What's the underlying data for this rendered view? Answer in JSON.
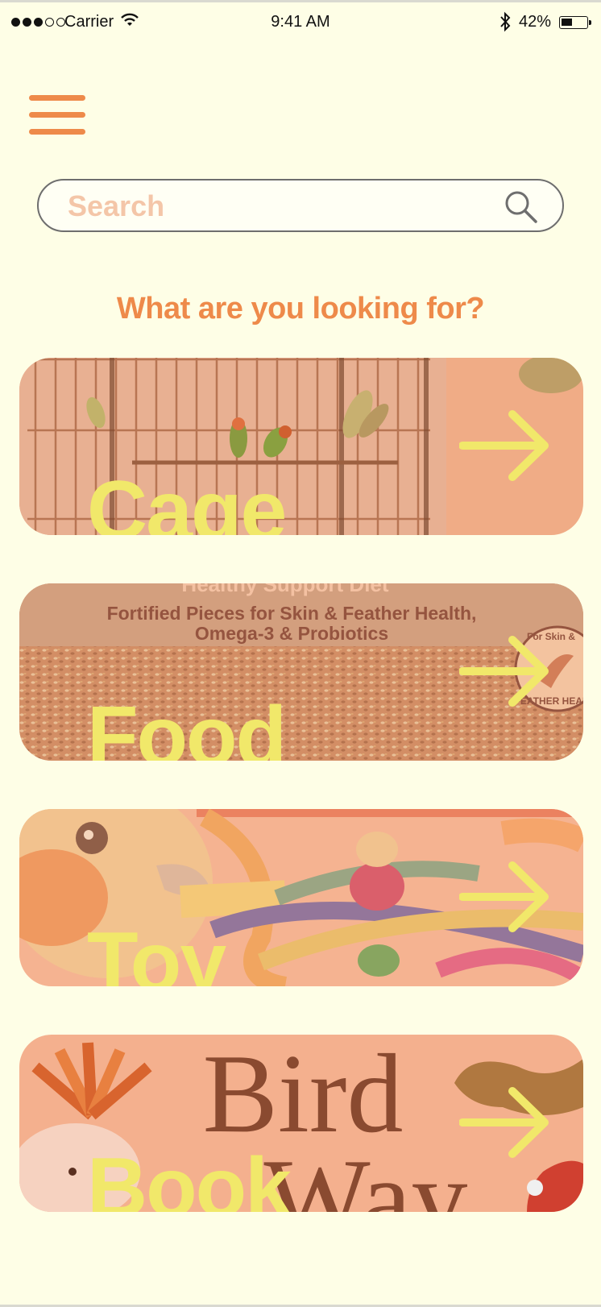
{
  "status_bar": {
    "carrier": "Carrier",
    "time": "9:41 AM",
    "battery_percent": "42%",
    "battery_level": 0.42
  },
  "search": {
    "placeholder": "Search",
    "value": ""
  },
  "heading": "What are you looking for?",
  "categories": [
    {
      "label": "Cage",
      "image_text": []
    },
    {
      "label": "Food",
      "image_text": [
        "Healthy Support Diet",
        "Fortified Pieces for Skin & Feather Health,",
        "Omega-3 & Probiotics",
        "For Skin &",
        "FEATHER HEALTH"
      ]
    },
    {
      "label": "Toy",
      "image_text": []
    },
    {
      "label": "Book",
      "image_text": [
        "Bird",
        "Way"
      ]
    }
  ],
  "colors": {
    "background": "#fefee6",
    "accent": "#ee8a4a",
    "card_label": "#f1e86a",
    "card_overlay": "#f4b28c"
  },
  "icons": {
    "menu": "hamburger-icon",
    "search": "search-icon",
    "arrow": "arrow-right-icon"
  }
}
